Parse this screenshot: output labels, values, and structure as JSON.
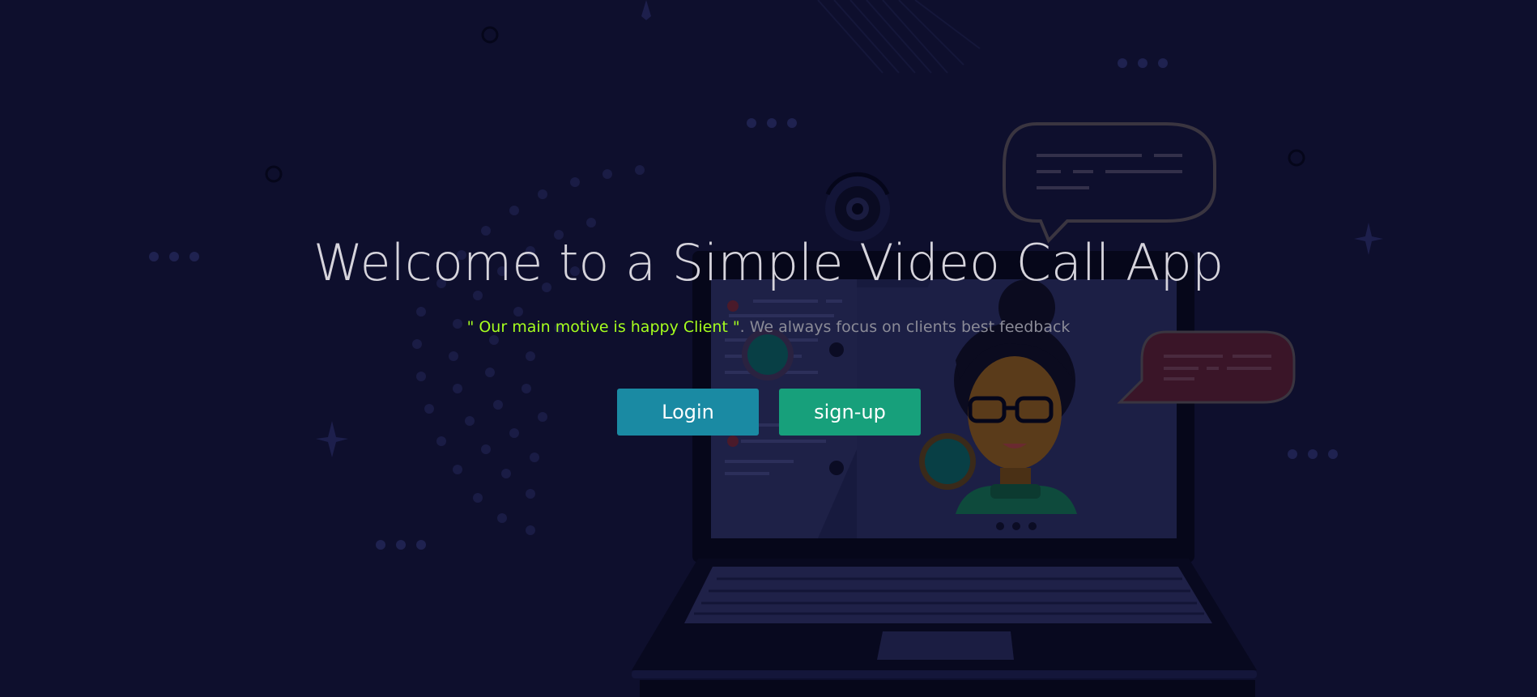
{
  "hero": {
    "title": "Welcome to a Simple Video Call App",
    "motto": "\" Our main motive is happy Client \"",
    "tagline": ". We always focus on clients best feedback"
  },
  "actions": {
    "login_label": "Login",
    "signup_label": "sign-up"
  },
  "colors": {
    "background": "#0e0f2d",
    "motto": "#a6ff1e",
    "login_button": "#1a8aa3",
    "signup_button": "#17a07b"
  }
}
